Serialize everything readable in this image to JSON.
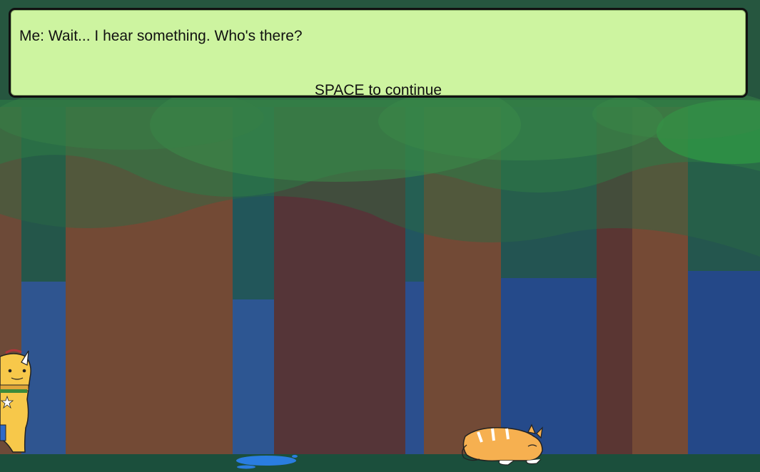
{
  "dialog": {
    "text": "Me: Wait... I hear something. Who's there?",
    "hint": "SPACE to continue"
  },
  "scene": {
    "name": "forest",
    "colors": {
      "sky": "#26563f",
      "ground": "#1b4f3c",
      "water": "#2a7de0",
      "dialog_bg": "#cdf4a0"
    }
  },
  "characters": [
    {
      "name": "yellow-unicorn-cat",
      "icon": "unicorn-character-icon"
    },
    {
      "name": "orange-cat",
      "icon": "crouching-cat-icon"
    }
  ]
}
